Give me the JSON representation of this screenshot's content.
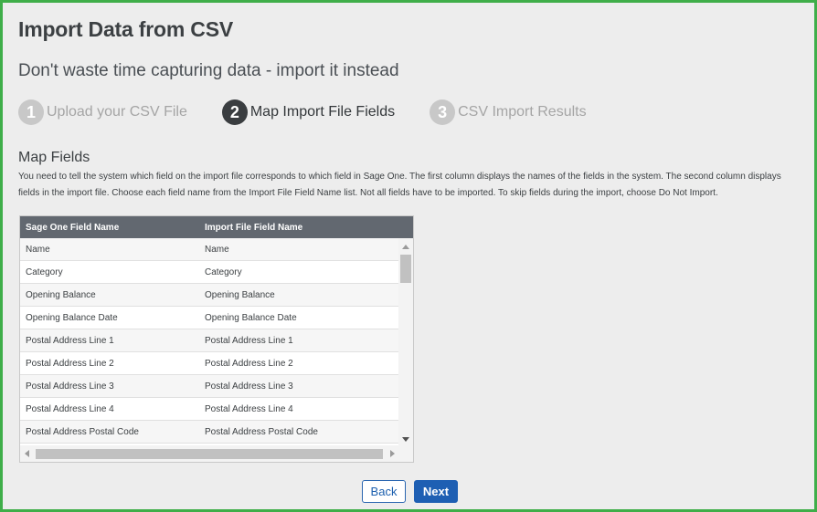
{
  "page": {
    "title": "Import Data from CSV",
    "subtitle": "Don't waste time capturing data - import it instead"
  },
  "steps": [
    {
      "number": "1",
      "label": "Upload your CSV File",
      "state": "inactive"
    },
    {
      "number": "2",
      "label": "Map Import File Fields",
      "state": "active"
    },
    {
      "number": "3",
      "label": "CSV Import Results",
      "state": "inactive"
    }
  ],
  "section": {
    "title": "Map Fields",
    "description": "You need to tell the system which field on the import file corresponds to which field in Sage One. The first column displays the names of the fields in the system. The second column displays fields in the import file. Choose each field name from the Import File Field Name list. Not all fields have to be imported. To skip fields during the import, choose Do Not Import."
  },
  "grid": {
    "columns": [
      "Sage One Field Name",
      "Import File Field Name"
    ],
    "rows": [
      [
        "Name",
        "Name"
      ],
      [
        "Category",
        "Category"
      ],
      [
        "Opening Balance",
        "Opening Balance"
      ],
      [
        "Opening Balance Date",
        "Opening Balance Date"
      ],
      [
        "Postal Address Line 1",
        "Postal Address Line 1"
      ],
      [
        "Postal Address Line 2",
        "Postal Address Line 2"
      ],
      [
        "Postal Address Line 3",
        "Postal Address Line 3"
      ],
      [
        "Postal Address Line 4",
        "Postal Address Line 4"
      ],
      [
        "Postal Address Postal Code",
        "Postal Address Postal Code"
      ],
      [
        "",
        ""
      ]
    ]
  },
  "buttons": {
    "back_label": "Back",
    "next_label": "Next"
  },
  "colors": {
    "frame_border": "#3fae49",
    "grid_header": "#626870",
    "primary": "#1e5fb3"
  },
  "icons": {
    "scroll_up": "triangle-up-icon",
    "scroll_down": "triangle-down-icon",
    "scroll_left": "triangle-left-icon",
    "scroll_right": "triangle-right-icon"
  }
}
